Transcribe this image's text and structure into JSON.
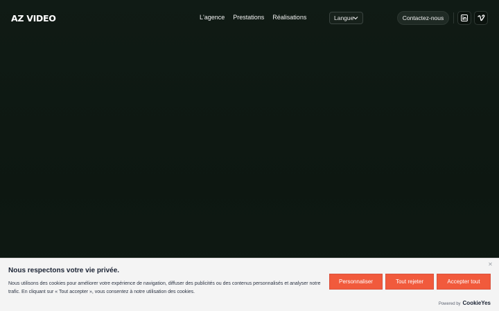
{
  "header": {
    "logo": "AZ VIDEO",
    "nav": [
      {
        "label": "L'agence"
      },
      {
        "label": "Prestations"
      },
      {
        "label": "Réalisations"
      }
    ],
    "language": {
      "label": "Langue"
    },
    "contact_label": "Contactez-nous",
    "social": [
      {
        "icon": "linkedin-icon"
      },
      {
        "icon": "vimeo-icon"
      }
    ]
  },
  "cookie_banner": {
    "title": "Nous respectons votre vie privée.",
    "text": "Nous utilisons des cookies pour améliorer votre expérience de navigation, diffuser des publicités ou des contenus personnalisés et analyser notre trafic. En cliquant sur « Tout accepter », vous consentez à notre utilisation des cookies.",
    "buttons": {
      "customize": "Personnaliser",
      "reject": "Tout rejeter",
      "accept": "Accepter tout"
    },
    "close_icon": "close-icon",
    "powered_by": "Powered by",
    "brand": "CookieYes"
  },
  "colors": {
    "background": "#0f1a14",
    "accent": "#f15a3c",
    "banner_bg": "#f4f4f4"
  }
}
